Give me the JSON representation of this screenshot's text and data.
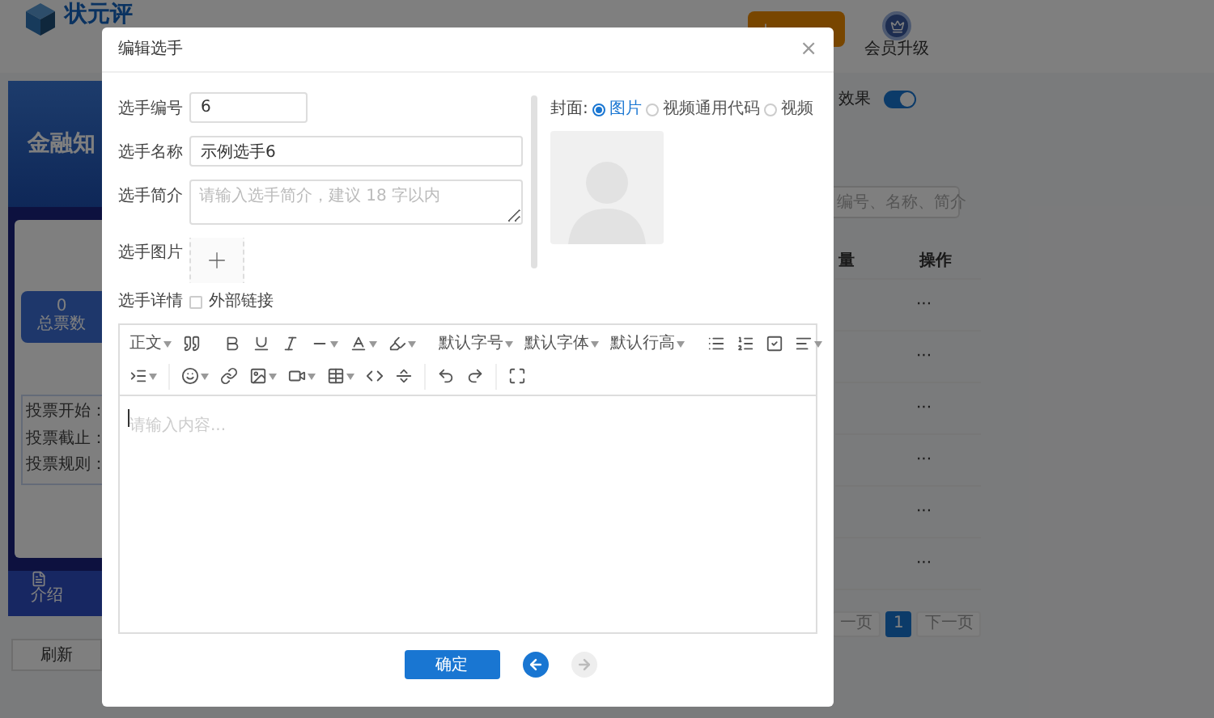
{
  "header": {
    "logo": "状元评",
    "vip": "会员升级"
  },
  "preview": {
    "banner": "金融知",
    "total": "0",
    "total_label": "总票数",
    "info": [
      "投票开始：",
      "投票截止：",
      "投票规则："
    ],
    "tab": "介绍",
    "refresh": "刷新"
  },
  "list": {
    "switch_label": "效果",
    "switch_on": true,
    "search_placeholder": "编号、名称、简介",
    "columns": [
      "量",
      "操作"
    ],
    "rows": [
      {
        "action": "···"
      },
      {
        "action": "···"
      },
      {
        "action": "···"
      },
      {
        "action": "···"
      },
      {
        "action": "···"
      },
      {
        "action": "···"
      }
    ],
    "pages": [
      {
        "label": "一页",
        "selected": false
      },
      {
        "label": "1",
        "selected": true
      },
      {
        "label": "下一页",
        "selected": false
      }
    ]
  },
  "dialog": {
    "title": "编辑选手",
    "close": "×",
    "fields": [
      {
        "label": "选手编号",
        "value": "6"
      },
      {
        "label": "选手名称",
        "value": "示例选手6"
      },
      {
        "label": "选手简介",
        "placeholder": "请输入选手简介，建议 18 字以内"
      }
    ],
    "image_label": "选手图片",
    "detail_label": "选手详情",
    "external_link": {
      "label": "外部链接",
      "checked": false
    },
    "cover_label": "封面:",
    "cover_options": [
      {
        "label": "图片",
        "selected": true
      },
      {
        "label": "视频通用代码",
        "selected": false
      },
      {
        "label": "视频",
        "selected": false
      }
    ],
    "editor": {
      "block_menu": "正文",
      "menus": [
        "默认字号",
        "默认字体",
        "默认行高"
      ],
      "placeholder": "请输入内容..."
    },
    "confirm": "确定",
    "prev_disabled": false,
    "next_disabled": true
  }
}
